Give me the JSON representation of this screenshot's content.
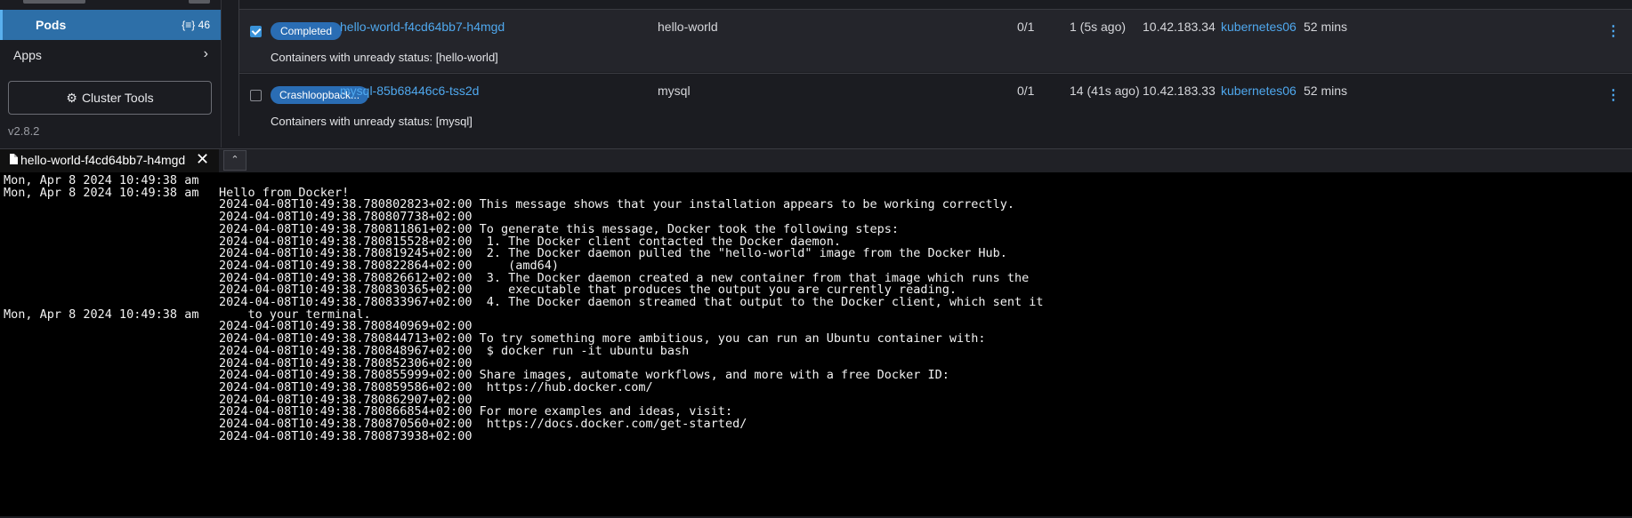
{
  "sidebar": {
    "pods_label": "Pods",
    "pods_count": "46",
    "apps_label": "Apps",
    "cluster_tools_label": "Cluster Tools",
    "version": "v2.8.2"
  },
  "pods": [
    {
      "checked": true,
      "status": "Completed",
      "name": "hello-world-f4cd64bb7-h4mgd",
      "image": "hello-world",
      "ready": "0/1",
      "restarts": "1 (5s ago)",
      "ip": "10.42.183.34",
      "node": "kubernetes06",
      "age": "52 mins",
      "sub": "Containers with unready status: [hello-world]"
    },
    {
      "checked": false,
      "status": "Crashloopback...",
      "name": "mysql-85b68446c6-tss2d",
      "image": "mysql",
      "ready": "0/1",
      "restarts": "14 (41s ago)",
      "ip": "10.42.183.33",
      "node": "kubernetes06",
      "age": "52 mins",
      "sub": "Containers with unready status: [mysql]"
    }
  ],
  "log_panel": {
    "tab_label": "hello-world-f4cd64bb7-h4mgd",
    "lines": [
      {
        "ts": "Mon, Apr 8 2024 10:49:38 am",
        "msg": ""
      },
      {
        "ts": "Mon, Apr 8 2024 10:49:38 am",
        "msg": "Hello from Docker!"
      },
      {
        "ts": "",
        "msg": "2024-04-08T10:49:38.780802823+02:00 This message shows that your installation appears to be working correctly."
      },
      {
        "ts": "",
        "msg": "2024-04-08T10:49:38.780807738+02:00"
      },
      {
        "ts": "",
        "msg": "2024-04-08T10:49:38.780811861+02:00 To generate this message, Docker took the following steps:"
      },
      {
        "ts": "",
        "msg": "2024-04-08T10:49:38.780815528+02:00  1. The Docker client contacted the Docker daemon."
      },
      {
        "ts": "",
        "msg": "2024-04-08T10:49:38.780819245+02:00  2. The Docker daemon pulled the \"hello-world\" image from the Docker Hub."
      },
      {
        "ts": "",
        "msg": "2024-04-08T10:49:38.780822864+02:00     (amd64)"
      },
      {
        "ts": "",
        "msg": "2024-04-08T10:49:38.780826612+02:00  3. The Docker daemon created a new container from that image which runs the"
      },
      {
        "ts": "",
        "msg": "2024-04-08T10:49:38.780830365+02:00     executable that produces the output you are currently reading."
      },
      {
        "ts": "",
        "msg": "2024-04-08T10:49:38.780833967+02:00  4. The Docker daemon streamed that output to the Docker client, which sent it"
      },
      {
        "ts": "Mon, Apr 8 2024 10:49:38 am",
        "msg": "    to your terminal."
      },
      {
        "ts": "",
        "msg": "2024-04-08T10:49:38.780840969+02:00"
      },
      {
        "ts": "",
        "msg": "2024-04-08T10:49:38.780844713+02:00 To try something more ambitious, you can run an Ubuntu container with:"
      },
      {
        "ts": "",
        "msg": "2024-04-08T10:49:38.780848967+02:00  $ docker run -it ubuntu bash"
      },
      {
        "ts": "",
        "msg": "2024-04-08T10:49:38.780852306+02:00"
      },
      {
        "ts": "",
        "msg": "2024-04-08T10:49:38.780855999+02:00 Share images, automate workflows, and more with a free Docker ID:"
      },
      {
        "ts": "",
        "msg": "2024-04-08T10:49:38.780859586+02:00  https://hub.docker.com/"
      },
      {
        "ts": "",
        "msg": "2024-04-08T10:49:38.780862907+02:00"
      },
      {
        "ts": "",
        "msg": "2024-04-08T10:49:38.780866854+02:00 For more examples and ideas, visit:"
      },
      {
        "ts": "",
        "msg": "2024-04-08T10:49:38.780870560+02:00  https://docs.docker.com/get-started/"
      },
      {
        "ts": "",
        "msg": "2024-04-08T10:49:38.780873938+02:00"
      }
    ]
  }
}
